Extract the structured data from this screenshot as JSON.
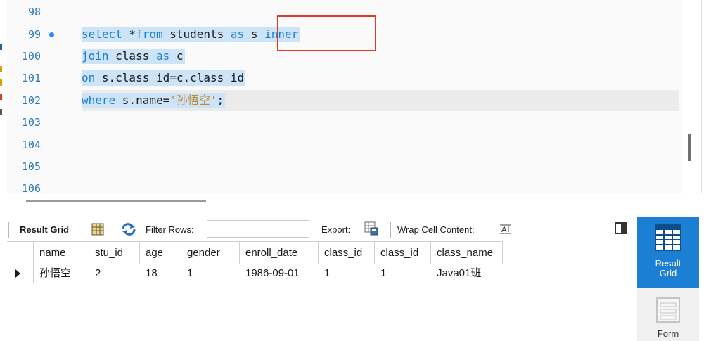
{
  "editor": {
    "lines": [
      {
        "num": "98",
        "tokens": []
      },
      {
        "num": "99",
        "tokens": [
          [
            "kw",
            "select"
          ],
          [
            "plain",
            " *"
          ],
          [
            "kw",
            "from"
          ],
          [
            "plain",
            " students "
          ],
          [
            "kw",
            "as"
          ],
          [
            "plain",
            " s "
          ],
          [
            "kw",
            "inner"
          ]
        ]
      },
      {
        "num": "100",
        "tokens": [
          [
            "kw",
            "join"
          ],
          [
            "plain",
            " class "
          ],
          [
            "kw",
            "as"
          ],
          [
            "plain",
            " c"
          ]
        ]
      },
      {
        "num": "101",
        "tokens": [
          [
            "kw",
            "on"
          ],
          [
            "plain",
            " s.class_id=c.class_id"
          ]
        ]
      },
      {
        "num": "102",
        "tokens": [
          [
            "kw",
            "where"
          ],
          [
            "plain",
            " s.name="
          ],
          [
            "str",
            "'孙悟空'"
          ],
          [
            "plain",
            ";"
          ]
        ]
      },
      {
        "num": "103",
        "tokens": []
      },
      {
        "num": "104",
        "tokens": []
      },
      {
        "num": "105",
        "tokens": []
      },
      {
        "num": "106",
        "tokens": []
      }
    ],
    "colors": {
      "keyword": "#1a7fd2",
      "string": "#c08a2e",
      "selection": "#cde3f7",
      "highlight_box": "#e0392a"
    }
  },
  "toolbar": {
    "result_grid_label": "Result Grid",
    "filter_rows_label": "Filter Rows:",
    "filter_rows_value": "",
    "export_label": "Export:",
    "wrap_cell_label": "Wrap Cell Content:"
  },
  "grid": {
    "columns": [
      "name",
      "stu_id",
      "age",
      "gender",
      "enroll_date",
      "class_id",
      "class_id",
      "class_name"
    ],
    "rows": [
      [
        "孙悟空",
        "2",
        "18",
        "1",
        "1986-09-01",
        "1",
        "1",
        "Java01班"
      ]
    ]
  },
  "side_panel": {
    "result_grid_label_1": "Result",
    "result_grid_label_2": "Grid",
    "form_label": "Form",
    "accent": "#1b7fd4"
  }
}
